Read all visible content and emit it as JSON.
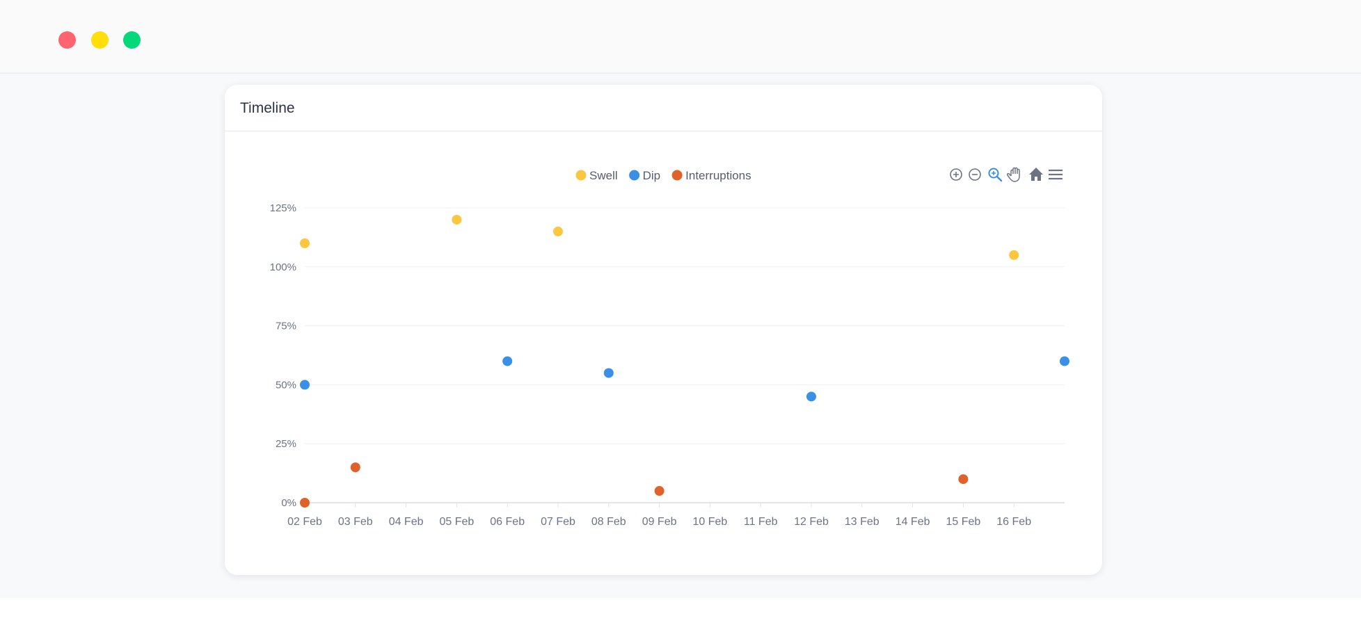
{
  "window": {
    "controls": [
      "close",
      "minimize",
      "maximize"
    ],
    "colors": {
      "close": "#ff6470",
      "minimize": "#ffde0a",
      "maximize": "#03d97a"
    }
  },
  "card": {
    "title": "Timeline"
  },
  "toolbar": {
    "icons": [
      "zoom-in-icon",
      "zoom-out-icon",
      "selection-zoom-icon",
      "pan-icon",
      "home-icon",
      "menu-icon"
    ],
    "active": "selection-zoom-icon"
  },
  "chart_data": {
    "type": "scatter",
    "title": "",
    "xlabel": "",
    "ylabel": "",
    "x_axis": {
      "type": "date",
      "ticks": [
        "02 Feb",
        "03 Feb",
        "04 Feb",
        "05 Feb",
        "06 Feb",
        "07 Feb",
        "08 Feb",
        "09 Feb",
        "10 Feb",
        "11 Feb",
        "12 Feb",
        "13 Feb",
        "14 Feb",
        "15 Feb",
        "16 Feb"
      ],
      "range": [
        "02 Feb",
        "17 Feb"
      ]
    },
    "y_axis": {
      "ticks": [
        "0%",
        "25%",
        "50%",
        "75%",
        "100%",
        "125%"
      ],
      "range": [
        0,
        125
      ]
    },
    "grid": "horizontal",
    "legend": "top-center",
    "series": [
      {
        "name": "Swell",
        "color": "#fbc73f",
        "points": [
          {
            "x": "02 Feb",
            "y": 110
          },
          {
            "x": "05 Feb",
            "y": 120
          },
          {
            "x": "07 Feb",
            "y": 115
          },
          {
            "x": "16 Feb",
            "y": 105
          }
        ]
      },
      {
        "name": "Dip",
        "color": "#3a8fe6",
        "points": [
          {
            "x": "02 Feb",
            "y": 50
          },
          {
            "x": "06 Feb",
            "y": 60
          },
          {
            "x": "08 Feb",
            "y": 55
          },
          {
            "x": "12 Feb",
            "y": 45
          },
          {
            "x": "17 Feb",
            "y": 60
          }
        ]
      },
      {
        "name": "Interruptions",
        "color": "#e0622a",
        "points": [
          {
            "x": "02 Feb",
            "y": 0
          },
          {
            "x": "03 Feb",
            "y": 15
          },
          {
            "x": "09 Feb",
            "y": 5
          },
          {
            "x": "15 Feb",
            "y": 10
          }
        ]
      }
    ]
  }
}
